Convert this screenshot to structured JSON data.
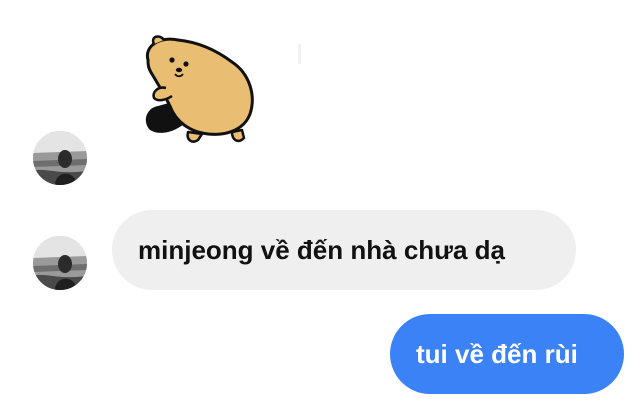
{
  "messages": {
    "incoming_text": "minjeong về đến nhà chưa dạ",
    "outgoing_text": "tui về đến rùi"
  },
  "sticker": {
    "icon": "hamster-sticker-icon",
    "color": "#E9BD72"
  },
  "avatar": {
    "icon": "profile-photo-avatar"
  },
  "colors": {
    "incoming_bubble": "#efefef",
    "outgoing_bubble": "#3b82f6",
    "outgoing_text": "#ffffff"
  }
}
